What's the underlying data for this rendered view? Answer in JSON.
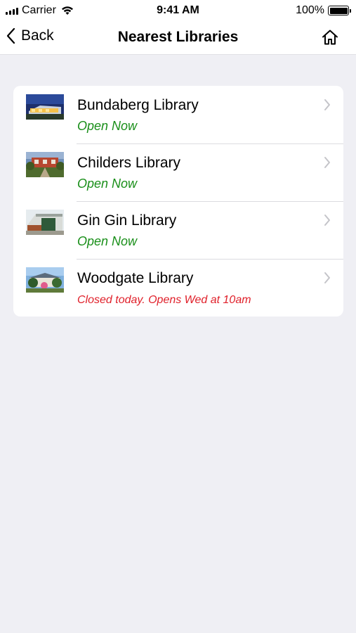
{
  "status_bar": {
    "carrier": "Carrier",
    "time": "9:41 AM",
    "battery": "100%"
  },
  "nav": {
    "back_label": "Back",
    "title": "Nearest Libraries",
    "home_icon": "home-icon"
  },
  "libraries": [
    {
      "name": "Bundaberg Library",
      "status": "Open Now",
      "status_type": "open"
    },
    {
      "name": "Childers Library",
      "status": "Open Now",
      "status_type": "open"
    },
    {
      "name": "Gin Gin Library",
      "status": "Open Now",
      "status_type": "open"
    },
    {
      "name": "Woodgate Library",
      "status": "Closed today. Opens Wed at 10am",
      "status_type": "closed"
    }
  ],
  "colors": {
    "open": "#1a8f1a",
    "closed": "#e0202a",
    "background": "#efeff4"
  }
}
